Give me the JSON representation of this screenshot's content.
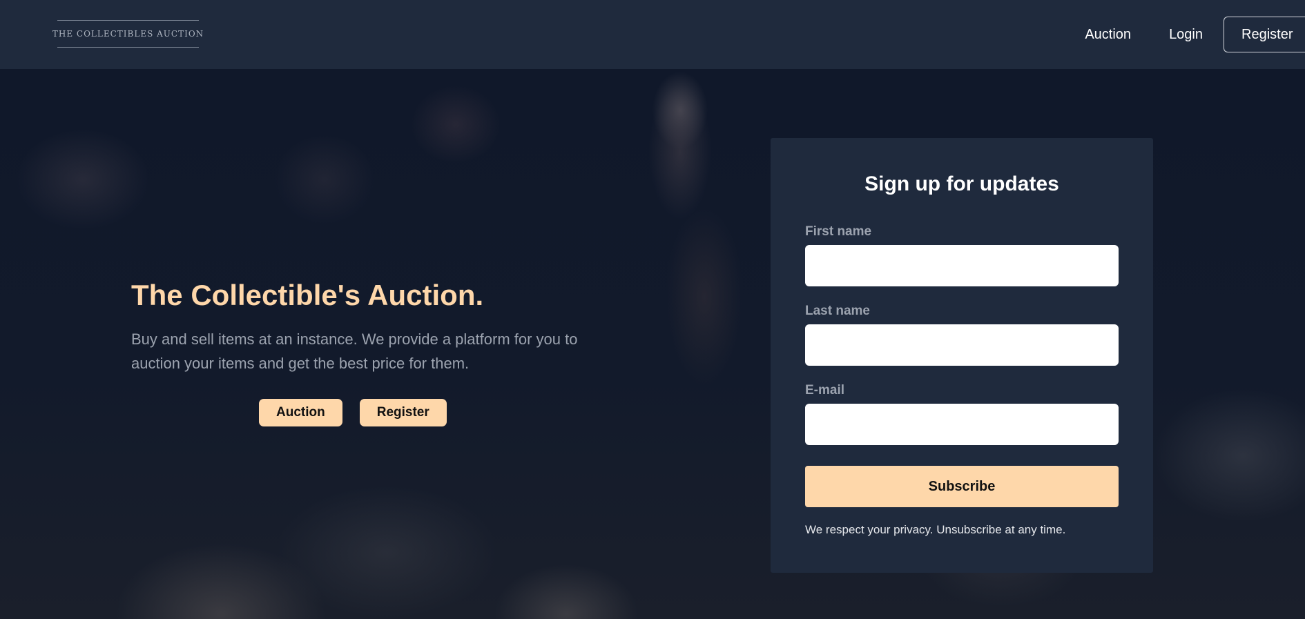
{
  "header": {
    "logo_text": "THE COLLECTIBLES AUCTION",
    "nav": {
      "auction": "Auction",
      "login": "Login",
      "register": "Register"
    }
  },
  "hero": {
    "title": "The Collectible's Auction.",
    "description": "Buy and sell items at an instance. We provide a platform for you to auction your items and get the best price for them.",
    "buttons": {
      "auction": "Auction",
      "register": "Register"
    }
  },
  "signup": {
    "title": "Sign up for updates",
    "first_name_label": "First name",
    "first_name_value": "",
    "last_name_label": "Last name",
    "last_name_value": "",
    "email_label": "E-mail",
    "email_value": "",
    "subscribe_label": "Subscribe",
    "privacy_text": "We respect your privacy. Unsubscribe at any time."
  },
  "colors": {
    "accent": "#fed7aa",
    "navbar_bg": "#1f2a3d",
    "muted_text": "#9ca3af"
  }
}
